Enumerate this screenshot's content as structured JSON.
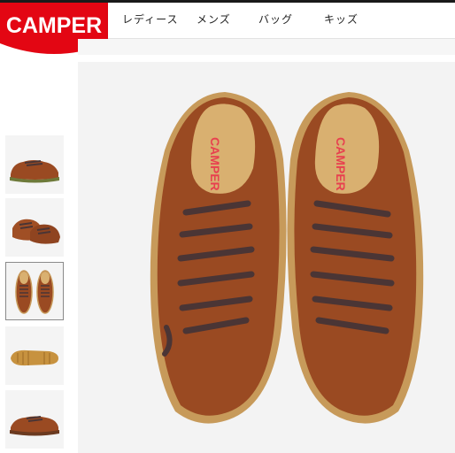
{
  "brand": {
    "name": "CAMPER",
    "logo_color": "#e30613"
  },
  "nav": {
    "items": [
      {
        "label": "レディース"
      },
      {
        "label": "メンズ"
      },
      {
        "label": "バッグ"
      },
      {
        "label": "キッズ"
      }
    ]
  },
  "gallery": {
    "thumbnails": [
      {
        "view": "side"
      },
      {
        "view": "pair-angle"
      },
      {
        "view": "top",
        "selected": true
      },
      {
        "view": "sole"
      },
      {
        "view": "side-inner"
      }
    ],
    "main_view": "top"
  },
  "product": {
    "insole_brand": "CAMPER",
    "colors": {
      "leather": "#9a4a22",
      "sole": "#c79a5a",
      "laces": "#4a3535",
      "insole": "#d9b070",
      "logo": "#e8404f"
    }
  }
}
